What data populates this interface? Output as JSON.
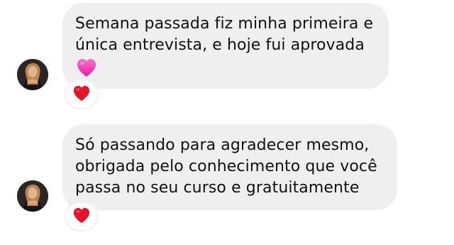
{
  "conversation": {
    "messages": [
      {
        "text": "Semana passada fiz minha primeira e\núnica entrevista, e hoje fui aprovada",
        "emoji": "pink-heart",
        "reaction": "red-heart"
      },
      {
        "text": "Só passando para agradecer mesmo,\nobrigada pelo conhecimento que você\npassa no seu curso e gratuitamente",
        "reaction": "red-heart"
      }
    ]
  },
  "colors": {
    "bubble": "#efefef",
    "text": "#111111",
    "red_heart": "#e4152b",
    "pink_heart": "#f53bb4"
  }
}
